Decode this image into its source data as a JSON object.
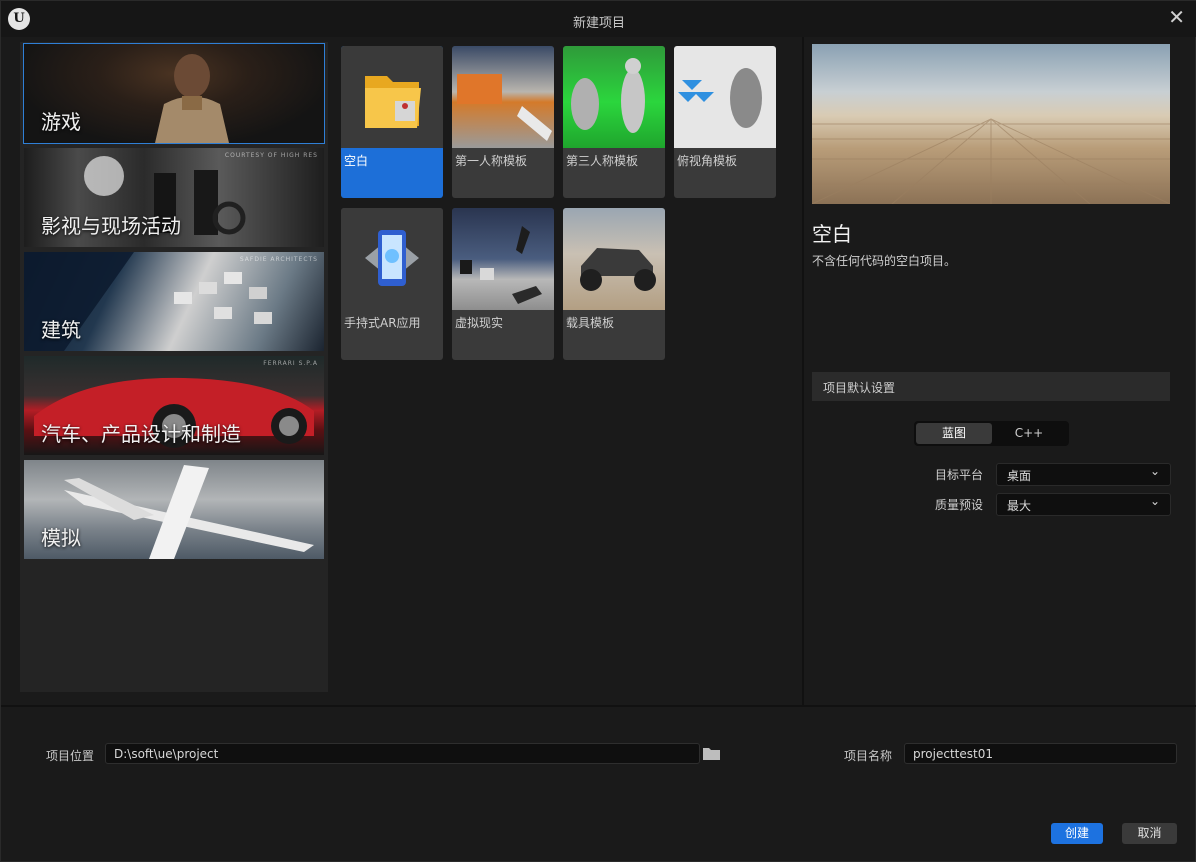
{
  "window": {
    "title": "新建项目"
  },
  "categories": [
    {
      "label": "游戏",
      "credit": ""
    },
    {
      "label": "影视与现场活动",
      "credit": "COURTESY OF HIGH RES"
    },
    {
      "label": "建筑",
      "credit": "SAFDIE ARCHITECTS"
    },
    {
      "label": "汽车、产品设计和制造",
      "credit": "FERRARI S.P.A"
    },
    {
      "label": "模拟",
      "credit": ""
    }
  ],
  "templates": [
    {
      "name": "空白",
      "icon": "folder-icon"
    },
    {
      "name": "第一人称模板",
      "icon": "first-person-thumb"
    },
    {
      "name": "第三人称模板",
      "icon": "third-person-thumb"
    },
    {
      "name": "俯视角模板",
      "icon": "top-down-thumb"
    },
    {
      "name": "手持式AR应用",
      "icon": "phone-ar-icon"
    },
    {
      "name": "虚拟现实",
      "icon": "vr-thumb"
    },
    {
      "name": "载具模板",
      "icon": "vehicle-thumb"
    }
  ],
  "details": {
    "title": "空白",
    "description": "不含任何代码的空白项目。",
    "section": "项目默认设置",
    "mode_blueprint": "蓝图",
    "mode_cpp": "C++",
    "target_platform_label": "目标平台",
    "target_platform_value": "桌面",
    "quality_label": "质量预设",
    "quality_value": "最大"
  },
  "footer": {
    "location_label": "项目位置",
    "location_value": "D:\\soft\\ue\\project",
    "name_label": "项目名称",
    "name_value": "projecttest01",
    "create_label": "创建",
    "cancel_label": "取消"
  },
  "colors": {
    "accent": "#1d72e0",
    "background": "#1a1a1a",
    "panel": "#242424"
  }
}
